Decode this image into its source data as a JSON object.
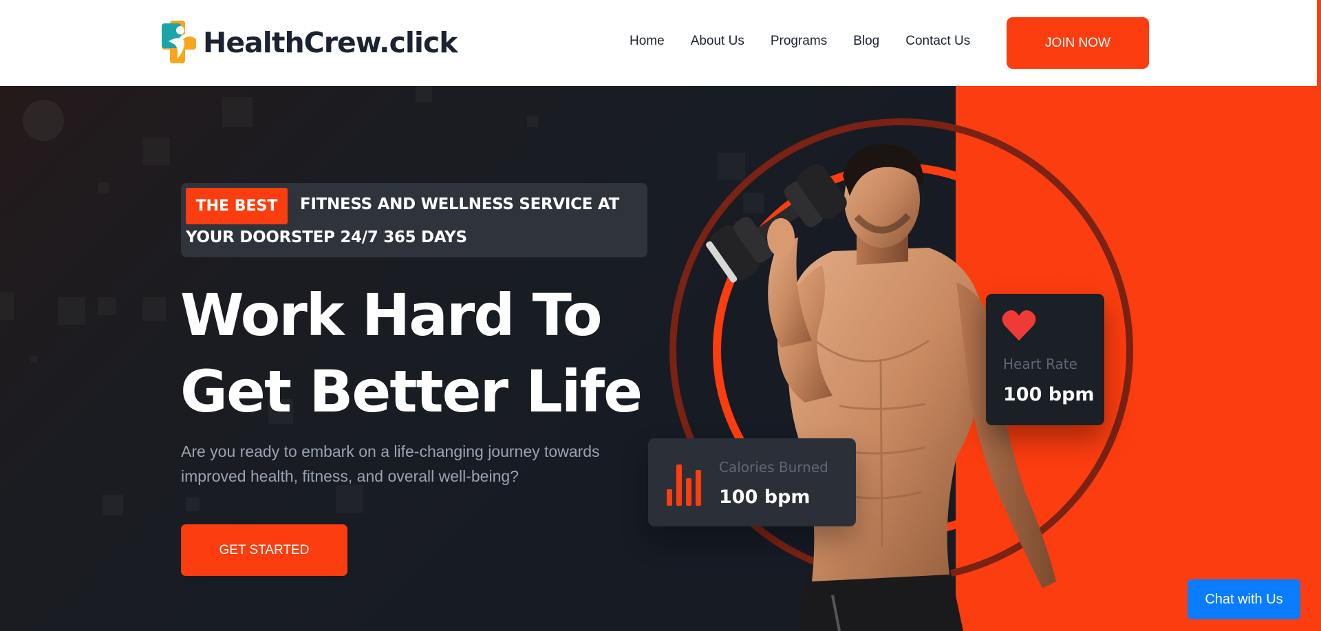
{
  "header": {
    "logo_text": "HealthCrew.click",
    "nav": [
      "Home",
      "About Us",
      "Programs",
      "Blog",
      "Contact Us"
    ],
    "join_label": "JOIN NOW"
  },
  "hero": {
    "tag_badge": "THE BEST",
    "tag_line1": "FITNESS AND WELLNESS SERVICE AT",
    "tag_line2": "YOUR DOORSTEP 24/7 365 DAYS",
    "headline_line1": "Work Hard To",
    "headline_line2": "Get Better Life",
    "subtext": "Are you ready to embark on a life-changing journey towards improved health, fitness, and overall well-being?",
    "cta_label": "GET STARTED"
  },
  "cards": {
    "heart_rate": {
      "label": "Heart Rate",
      "value": "100 bpm",
      "icon": "heart-icon"
    },
    "calories": {
      "label": "Calories Burned",
      "value": "100 bpm",
      "icon": "bar-chart-icon"
    }
  },
  "chat": {
    "label": "Chat with Us"
  },
  "colors": {
    "accent": "#fc3d0f",
    "dark": "#161b24",
    "chat": "#0a7cff"
  }
}
